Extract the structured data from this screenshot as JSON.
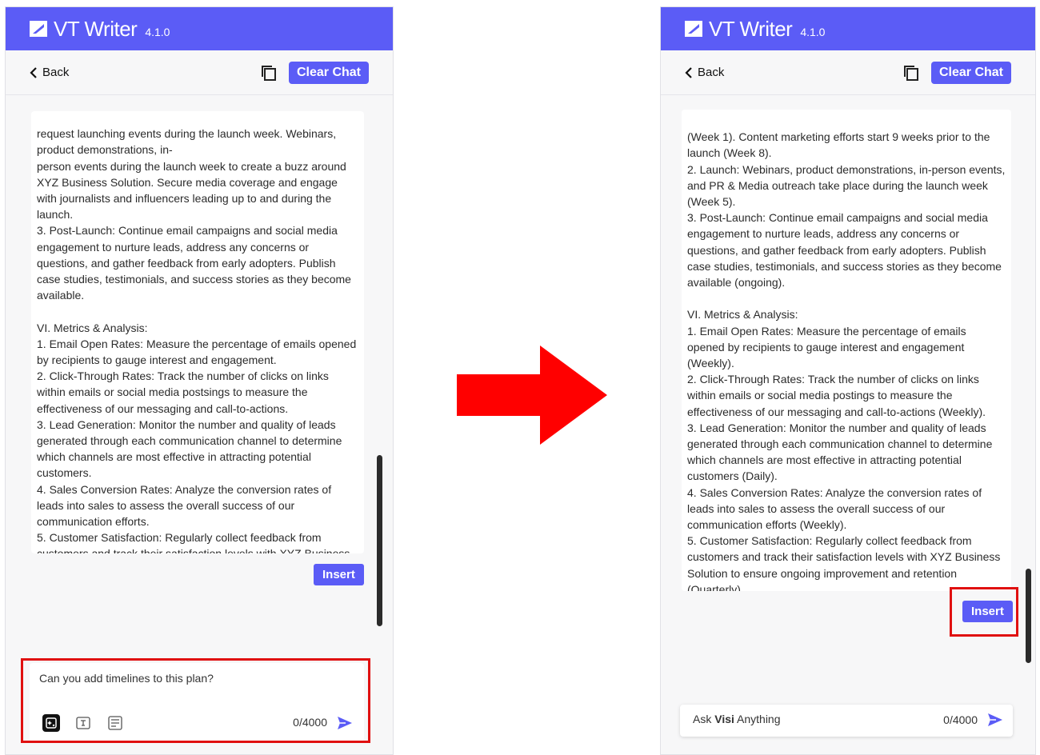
{
  "app": {
    "name": "VT Writer",
    "version": "4.1.0",
    "back_label": "Back",
    "clear_chat_label": "Clear Chat",
    "insert_label": "Insert",
    "accent_color": "#5b5cf6",
    "highlight_color": "#e01010"
  },
  "left_panel": {
    "message_text": "request launching events during the launch week. Webinars, product demonstrations, in-\nperson events during the launch week to create a buzz around XYZ Business Solution. Secure media coverage and engage with journalists and influencers leading up to and during the launch.\n3. Post-Launch: Continue email campaigns and social media engagement to nurture leads, address any concerns or questions, and gather feedback from early adopters. Publish case studies, testimonials, and success stories as they become available.\n\nVI. Metrics & Analysis:\n1. Email Open Rates: Measure the percentage of emails opened by recipients to gauge interest and engagement.\n2. Click-Through Rates: Track the number of clicks on links within emails or social media postsings to measure the effectiveness of our messaging and call-to-actions.\n3. Lead Generation: Monitor the number and quality of leads generated through each communication channel to determine which channels are most effective in attracting potential customers.\n4. Sales Conversion Rates: Analyze the conversion rates of leads into sales to assess the overall success of our communication efforts.\n5. Customer Satisfaction: Regularly collect feedback from customers and track their satisfaction levels with XYZ Business Solution to ensure ongoing improvement and retention.",
    "input_value": "Can you add timelines to this plan?",
    "char_count": "0/4000"
  },
  "right_panel": {
    "message_text": "(Week 1). Content marketing efforts start 9 weeks prior to the launch (Week 8).\n2. Launch: Webinars, product demonstrations, in-person events, and PR & Media outreach take place during the launch week (Week 5).\n3. Post-Launch: Continue email campaigns and social media engagement to nurture leads, address any concerns or questions, and gather feedback from early adopters. Publish case studies, testimonials, and success stories as they become available (ongoing).\n\nVI. Metrics & Analysis:\n1. Email Open Rates: Measure the percentage of emails opened by recipients to gauge interest and engagement (Weekly).\n2. Click-Through Rates: Track the number of clicks on links within emails or social media postings to measure the effectiveness of our messaging and call-to-actions (Weekly).\n3. Lead Generation: Monitor the number and quality of leads generated through each communication channel to determine which channels are most effective in attracting potential customers (Daily).\n4. Sales Conversion Rates: Analyze the conversion rates of leads into sales to assess the overall success of our communication efforts (Weekly).\n5. Customer Satisfaction: Regularly collect feedback from customers and track their satisfaction levels with XYZ Business Solution to ensure ongoing improvement and retention (Quarterly).",
    "ask_prefix": "Ask",
    "ask_brand": "Visi",
    "ask_suffix": "Anything",
    "char_count": "0/4000"
  },
  "icons": {
    "logo": "logo-mark-icon",
    "back": "chevron-left-icon",
    "copy": "copy-icon",
    "tool_1": "ai-sparkle-icon",
    "tool_2": "text-format-icon",
    "tool_3": "document-icon",
    "send": "send-icon",
    "transition": "arrow-right-icon"
  }
}
